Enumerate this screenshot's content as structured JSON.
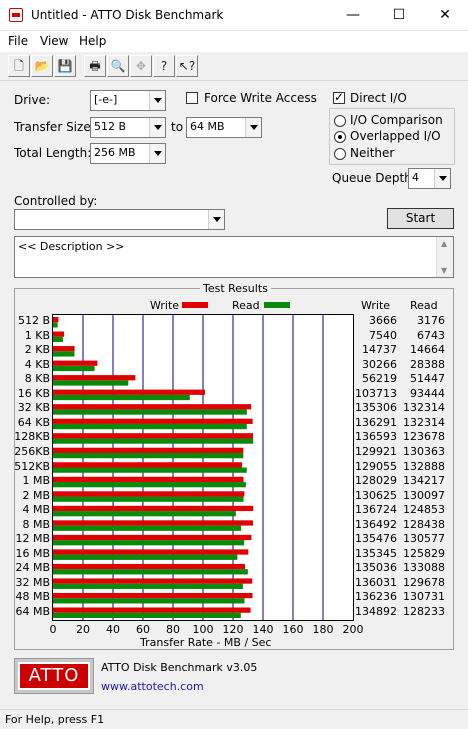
{
  "window": {
    "title": "Untitled - ATTO Disk Benchmark"
  },
  "titlebar_buttons": {
    "minimize": "—",
    "maximize": "☐",
    "close": "✕"
  },
  "menu": {
    "file": "File",
    "view": "View",
    "help": "Help"
  },
  "toolbar": {
    "new_icon": "🗋",
    "open_icon": "📂",
    "save_icon": "💾",
    "print_icon": "🖶",
    "preview_icon": "🔍",
    "move_icon": "✥",
    "help_icon": "?",
    "context_help_icon": "↖?"
  },
  "form": {
    "drive_label": "Drive:",
    "drive_value": "[-e-]",
    "transfer_label": "Transfer Size:",
    "transfer_from": "512 B",
    "transfer_to_label": "to",
    "transfer_to": "64 MB",
    "total_length_label": "Total Length:",
    "total_length": "256 MB",
    "force_write_label": "Force Write Access",
    "force_write_checked": false,
    "direct_io_label": "Direct I/O",
    "direct_io_checked": true,
    "io_comparison_label": "I/O Comparison",
    "overlapped_io_label": "Overlapped I/O",
    "neither_label": "Neither",
    "selected_io": "Overlapped I/O",
    "queue_depth_label": "Queue Depth:",
    "queue_depth": "4",
    "controlled_by_label": "Controlled by:",
    "controlled_by_value": "",
    "start_button": "Start",
    "description_text": "<< Description >>"
  },
  "results": {
    "group_title": "Test Results",
    "legend_write": "Write",
    "legend_read": "Read",
    "col_write": "Write",
    "col_read": "Read",
    "xaxis_label": "Transfer Rate - MB / Sec"
  },
  "colors": {
    "write": "#e00000",
    "read": "#0a8a0a",
    "grid": "#00008b"
  },
  "chart_data": {
    "type": "bar",
    "orientation": "horizontal",
    "xlabel": "Transfer Rate - MB / Sec",
    "xlim": [
      0,
      200
    ],
    "xticks": [
      0,
      20,
      40,
      60,
      80,
      100,
      120,
      140,
      160,
      180,
      200
    ],
    "categories": [
      "512 B",
      "1 KB",
      "2 KB",
      "4 KB",
      "8 KB",
      "16 KB",
      "32 KB",
      "64 KB",
      "128KB",
      "256KB",
      "512KB",
      "1 MB",
      "2 MB",
      "4 MB",
      "8 MB",
      "12 MB",
      "16 MB",
      "24 MB",
      "32 MB",
      "48 MB",
      "64 MB"
    ],
    "series": [
      {
        "name": "Write",
        "values": [
          3.6,
          7.4,
          14.4,
          29.6,
          54.9,
          101.3,
          132.1,
          133.1,
          133.4,
          126.9,
          126.0,
          127.0,
          127.6,
          133.5,
          133.3,
          132.3,
          130.2,
          128.0,
          132.8,
          133.0,
          131.7
        ],
        "text_values": [
          "3666",
          "7540",
          "14737",
          "30266",
          "56219",
          "103713",
          "135306",
          "136291",
          "136593",
          "129921",
          "129055",
          "128029",
          "130625",
          "136724",
          "136492",
          "135476",
          "135345",
          "135036",
          "136031",
          "136236",
          "134892"
        ]
      },
      {
        "name": "Read",
        "values": [
          3.1,
          6.6,
          14.3,
          27.7,
          50.2,
          91.2,
          129.2,
          129.2,
          133.5,
          126.9,
          129.2,
          128.6,
          127.0,
          121.9,
          125.4,
          127.5,
          122.9,
          129.9,
          126.6,
          127.7,
          125.2
        ],
        "text_values": [
          "3176",
          "6743",
          "14664",
          "28388",
          "51447",
          "93444",
          "132314",
          "132314",
          "123678",
          "130363",
          "132888",
          "134217",
          "130097",
          "124853",
          "128438",
          "130577",
          "125829",
          "133088",
          "129678",
          "130731",
          "128233"
        ]
      }
    ]
  },
  "logo": {
    "text": "ATTO",
    "product": "ATTO Disk Benchmark v3.05",
    "url": "www.attotech.com"
  },
  "status": {
    "text": "For Help, press F1"
  }
}
